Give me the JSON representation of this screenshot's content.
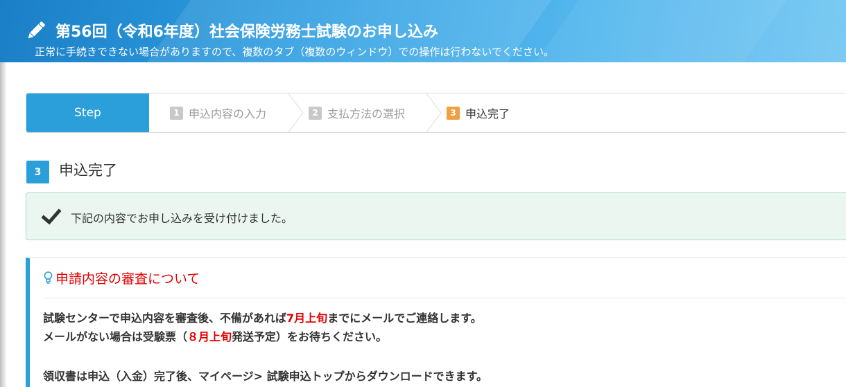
{
  "header": {
    "title": "第56回（令和6年度）社会保険労務士試験のお申し込み",
    "notice": "正常に手続きできない場合がありますので、複数のタブ（複数のウィンドウ）での操作は行わないでください。",
    "icon": "pencil-icon",
    "gradient_start": "#1b7fc6",
    "gradient_end": "#7ccaf3"
  },
  "steps": {
    "head_label": "Step",
    "items": [
      {
        "num": "1",
        "label": "申込内容の入力",
        "state": "done"
      },
      {
        "num": "2",
        "label": "支払方法の選択",
        "state": "done"
      },
      {
        "num": "3",
        "label": "申込完了",
        "state": "current"
      }
    ],
    "accent_color": "#2b9fd9",
    "current_color": "#f0a040"
  },
  "section": {
    "number": "3",
    "title": "申込完了"
  },
  "alert": {
    "icon": "check-icon",
    "message": "下記の内容でお申し込みを受け付けました。"
  },
  "review_panel": {
    "icon": "lightbulb-icon",
    "title": "申請内容の審査について",
    "line1_before": "試験センターで申込内容を審査後、不備があれば",
    "line1_highlight": "7月上旬",
    "line1_after": "までにメールでご連絡します。",
    "line2_before": "メールがない場合は受験票（",
    "line2_highlight": "８月上旬",
    "line2_after": "発送予定）をお待ちください。",
    "line3": "領収書は申込（入金）完了後、マイページ> 試験申込トップからダウンロードできます。",
    "highlight_color": "#e00000"
  }
}
